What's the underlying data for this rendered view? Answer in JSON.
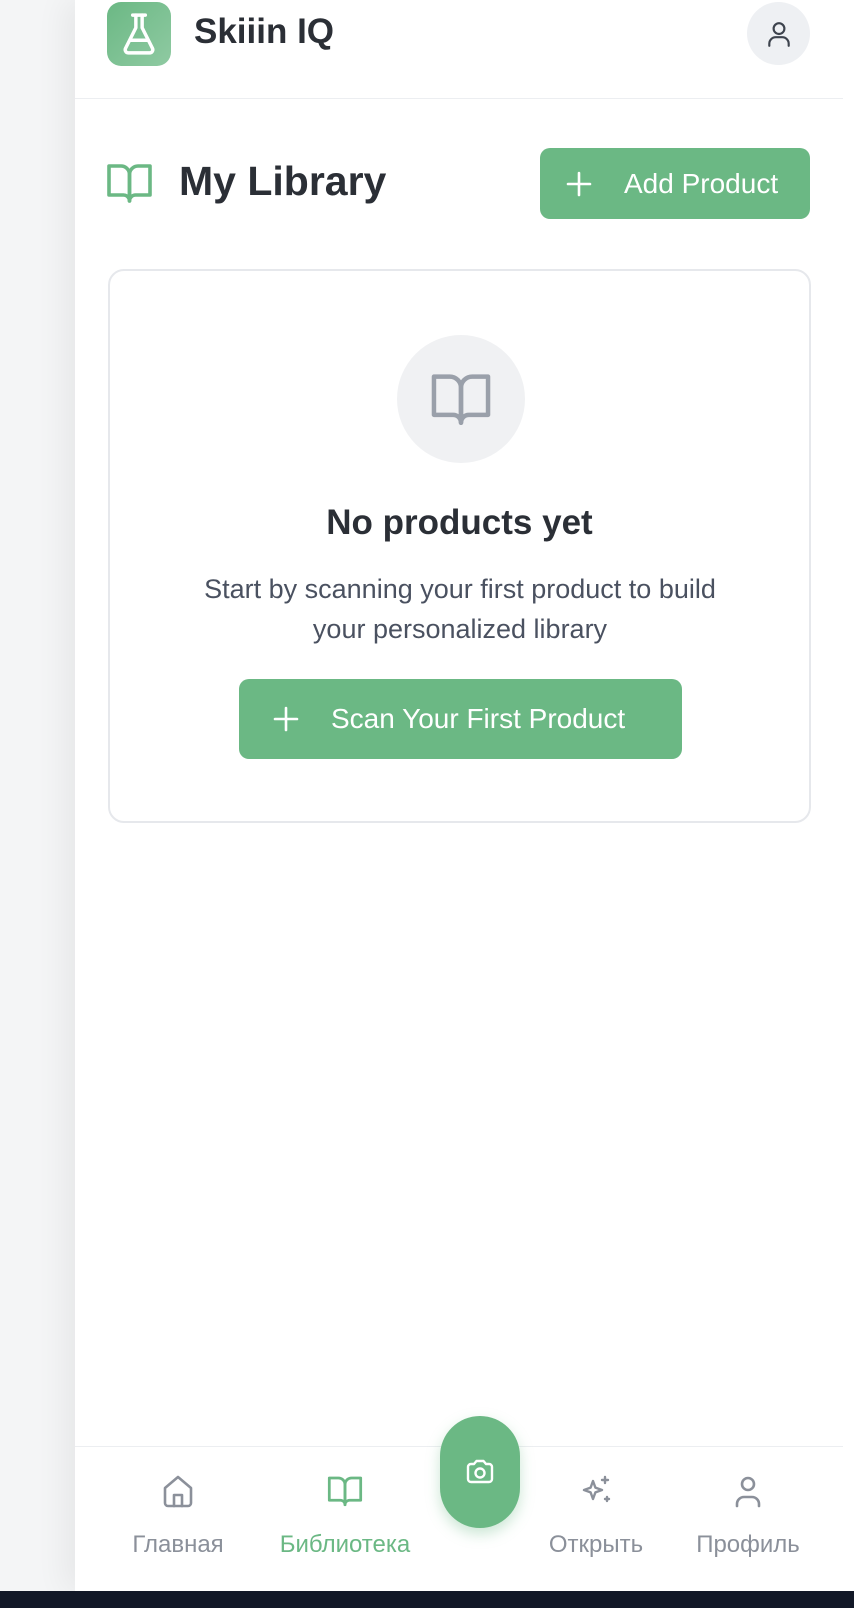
{
  "header": {
    "app_title": "Skiiin IQ",
    "logo_icon": "flask-icon",
    "avatar_icon": "user-icon"
  },
  "library": {
    "title": "My Library",
    "icon": "book-open-icon",
    "add_button_label": "Add Product"
  },
  "empty_state": {
    "icon": "book-open-icon",
    "title": "No products yet",
    "description": "Start by scanning your first product to build your personalized library",
    "scan_button_label": "Scan Your First Product"
  },
  "bottom_nav": {
    "items": [
      {
        "label": "Главная",
        "icon": "home-icon",
        "active": false
      },
      {
        "label": "Библиотека",
        "icon": "book-open-icon",
        "active": true
      },
      {
        "label": "Открыть",
        "icon": "sparkles-icon",
        "active": false
      },
      {
        "label": "Профиль",
        "icon": "user-icon",
        "active": false
      }
    ],
    "camera_icon": "camera-icon"
  },
  "colors": {
    "accent": "#6bb884",
    "text": "#2b2f36",
    "muted": "#8b909a"
  }
}
